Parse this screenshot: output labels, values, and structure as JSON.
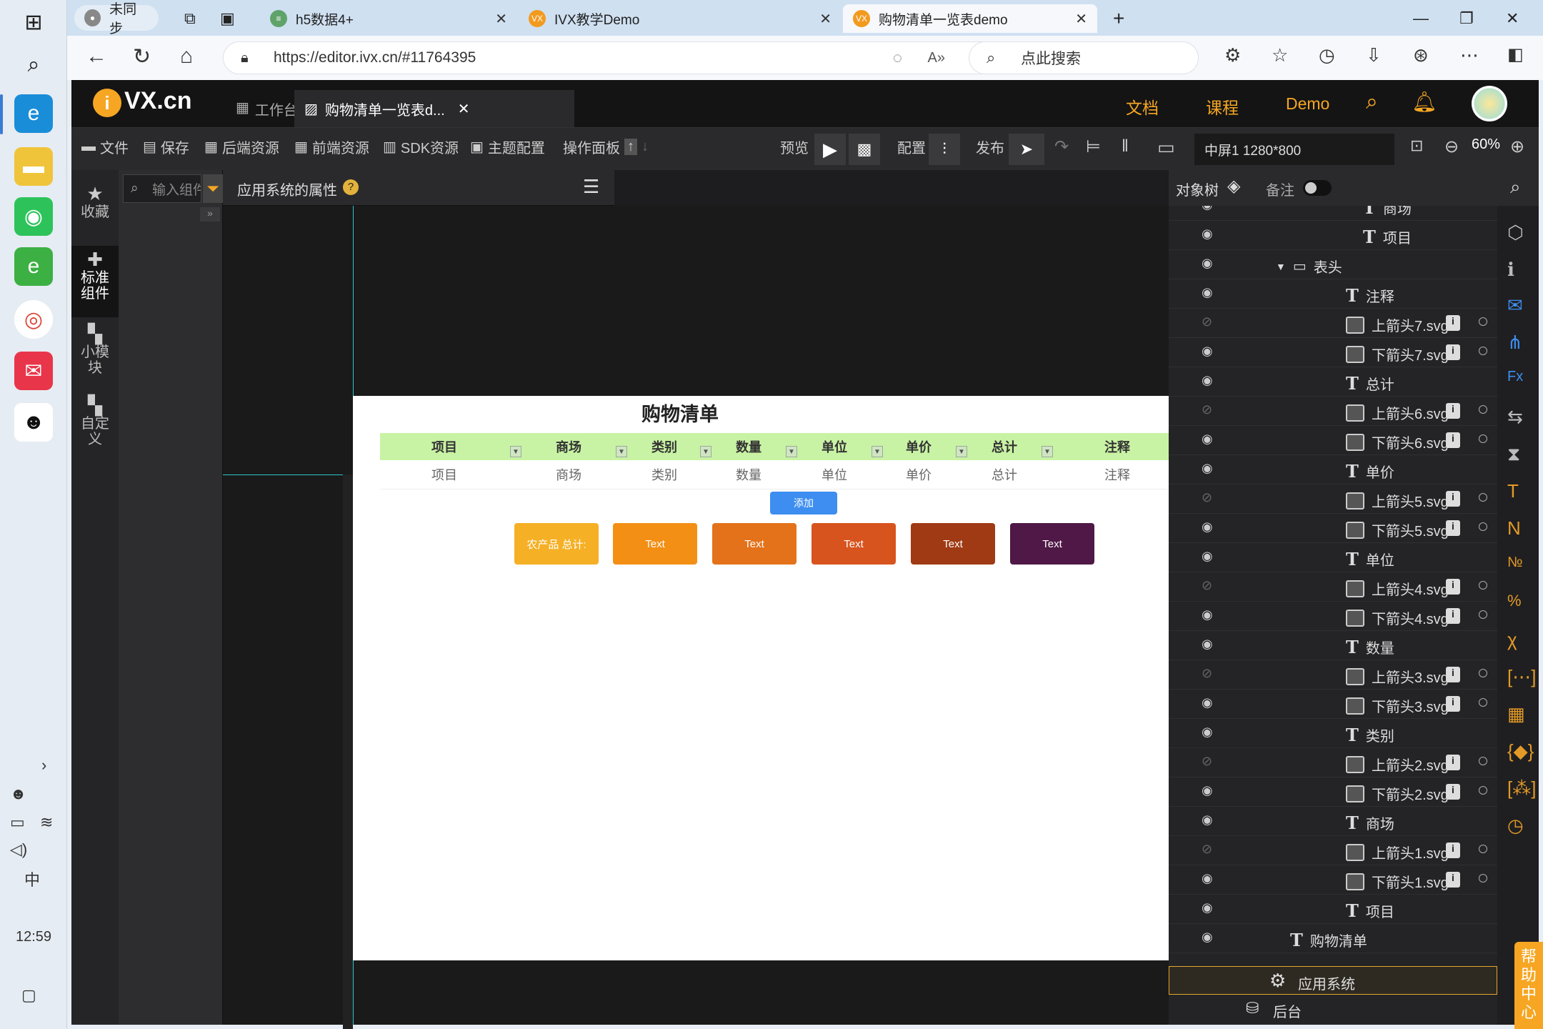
{
  "taskbar": {
    "clock": "12:59",
    "ime": "中"
  },
  "browser": {
    "profile_label": "未同步",
    "tabs": [
      {
        "label": "h5数据4+"
      },
      {
        "label": "IVX教学Demo",
        "favicon": "VX"
      },
      {
        "label": "购物清单一览表demo",
        "favicon": "VX"
      }
    ],
    "url": "https://editor.ivx.cn/#11764395",
    "search_placeholder": "点此搜索"
  },
  "app": {
    "logo": "VX.cn",
    "tabs": [
      {
        "label": "工作台"
      },
      {
        "label": "购物清单一览表d..."
      }
    ],
    "header_links": [
      "文档",
      "课程",
      "Demo"
    ],
    "toolbar": {
      "file": "文件",
      "save": "保存",
      "backend": "后端资源",
      "frontend": "前端资源",
      "sdk": "SDK资源",
      "theme": "主题配置",
      "panel": "操作面板",
      "preview": "预览",
      "config": "配置",
      "publish": "发布",
      "screen": "中屏1 1280*800",
      "zoom": "60%"
    },
    "left_rail": [
      {
        "label": "收藏",
        "icon": "star-icon"
      },
      {
        "label": "标准组件",
        "icon": "puzzle-icon"
      },
      {
        "label": "小模块",
        "icon": "module-icon"
      },
      {
        "label": "自定义",
        "icon": "custom-icon"
      }
    ],
    "component_search_placeholder": "输入组件名称",
    "property_title": "应用系统的属性",
    "property_help": "?",
    "canvas": {
      "page_title": "购物清单",
      "headers": [
        "项目",
        "商场",
        "类别",
        "数量",
        "单位",
        "单价",
        "总计",
        "注释"
      ],
      "row": [
        "项目",
        "商场",
        "类别",
        "数量",
        "单位",
        "单价",
        "总计",
        "注释"
      ],
      "add_button": "添加",
      "cards": [
        {
          "label": "农产品 总计:",
          "color": "#f5b025"
        },
        {
          "label": "Text",
          "color": "#f38f15"
        },
        {
          "label": "Text",
          "color": "#e3721a"
        },
        {
          "label": "Text",
          "color": "#d8541e"
        },
        {
          "label": "Text",
          "color": "#9f3a14"
        },
        {
          "label": "Text",
          "color": "#4f1846"
        }
      ]
    },
    "tree_header": {
      "object_tree": "对象树",
      "notes": "备注"
    },
    "tree": [
      {
        "label": "商场",
        "type": "text",
        "visible": true,
        "indent": 2
      },
      {
        "label": "项目",
        "type": "text",
        "visible": true,
        "indent": 2
      },
      {
        "label": "表头",
        "type": "row",
        "visible": true,
        "indent": 0
      },
      {
        "label": "注释",
        "type": "text",
        "visible": true,
        "indent": 1
      },
      {
        "label": "上箭头7.svg",
        "type": "image",
        "visible": false,
        "indent": 1
      },
      {
        "label": "下箭头7.svg",
        "type": "image",
        "visible": true,
        "indent": 1
      },
      {
        "label": "总计",
        "type": "text",
        "visible": true,
        "indent": 1
      },
      {
        "label": "上箭头6.svg",
        "type": "image",
        "visible": false,
        "indent": 1
      },
      {
        "label": "下箭头6.svg",
        "type": "image",
        "visible": true,
        "indent": 1
      },
      {
        "label": "单价",
        "type": "text",
        "visible": true,
        "indent": 1
      },
      {
        "label": "上箭头5.svg",
        "type": "image",
        "visible": false,
        "indent": 1
      },
      {
        "label": "下箭头5.svg",
        "type": "image",
        "visible": true,
        "indent": 1
      },
      {
        "label": "单位",
        "type": "text",
        "visible": true,
        "indent": 1
      },
      {
        "label": "上箭头4.svg",
        "type": "image",
        "visible": false,
        "indent": 1
      },
      {
        "label": "下箭头4.svg",
        "type": "image",
        "visible": true,
        "indent": 1
      },
      {
        "label": "数量",
        "type": "text",
        "visible": true,
        "indent": 1
      },
      {
        "label": "上箭头3.svg",
        "type": "image",
        "visible": false,
        "indent": 1
      },
      {
        "label": "下箭头3.svg",
        "type": "image",
        "visible": true,
        "indent": 1
      },
      {
        "label": "类别",
        "type": "text",
        "visible": true,
        "indent": 1
      },
      {
        "label": "上箭头2.svg",
        "type": "image",
        "visible": false,
        "indent": 1
      },
      {
        "label": "下箭头2.svg",
        "type": "image",
        "visible": true,
        "indent": 1
      },
      {
        "label": "商场",
        "type": "text",
        "visible": true,
        "indent": 1
      },
      {
        "label": "上箭头1.svg",
        "type": "image",
        "visible": false,
        "indent": 1
      },
      {
        "label": "下箭头1.svg",
        "type": "image",
        "visible": true,
        "indent": 1
      },
      {
        "label": "项目",
        "type": "text",
        "visible": true,
        "indent": 1
      },
      {
        "label": "购物清单",
        "type": "text",
        "visible": true,
        "indent": 0
      }
    ],
    "tree_footer": {
      "system": "应用系统",
      "backend": "后台"
    },
    "help_center": "帮助中心"
  }
}
